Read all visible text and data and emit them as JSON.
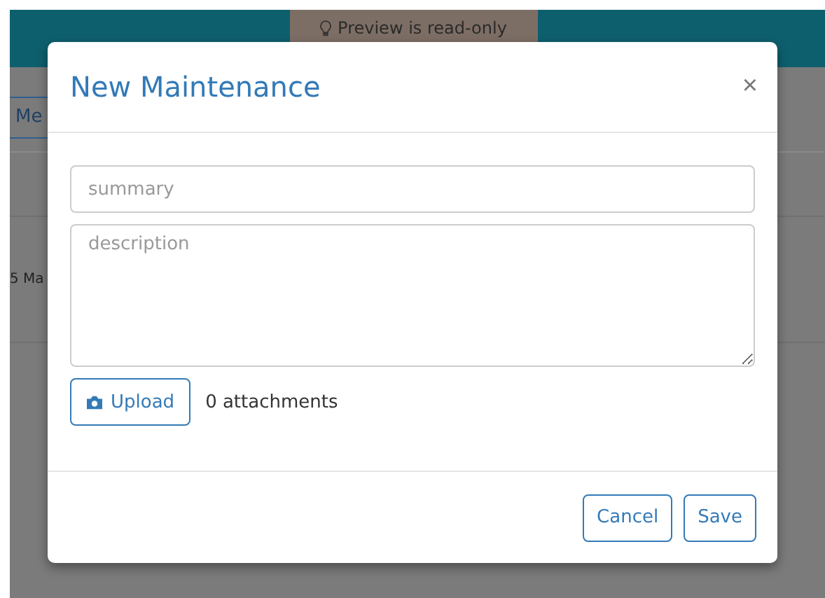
{
  "background": {
    "banner": "Preview is read-only",
    "tab": "Me",
    "row_text": "5 Ma"
  },
  "dialog": {
    "title": "New Maintenance",
    "close": "×",
    "summary": {
      "placeholder": "summary"
    },
    "description": {
      "placeholder": "description"
    },
    "upload_button": "Upload",
    "attachments": "0 attachments",
    "buttons": [
      "Cancel",
      "Save"
    ]
  }
}
